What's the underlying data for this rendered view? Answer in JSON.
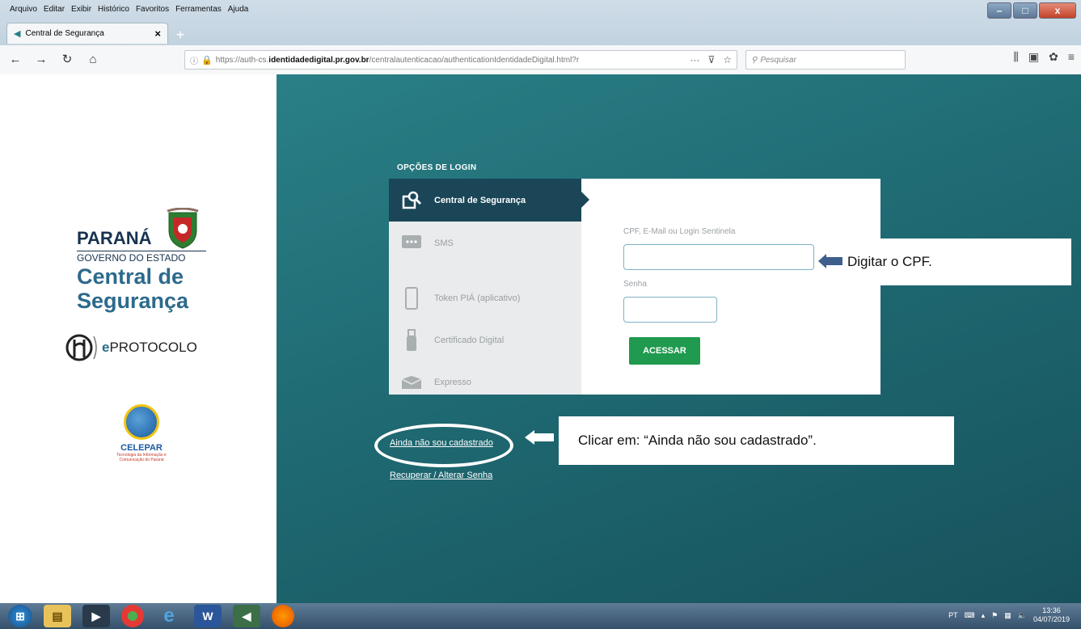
{
  "browser": {
    "menu": [
      "Arquivo",
      "Editar",
      "Exibir",
      "Histórico",
      "Favoritos",
      "Ferramentas",
      "Ajuda"
    ],
    "tab_title": "Central de Segurança",
    "tab_close": "×",
    "new_tab": "+",
    "url_prefix": "https://auth-cs.",
    "url_domain": "identidadedigital.pr.gov.br",
    "url_path": "/centralautenticacao/authenticationIdentidadeDigital.html?r",
    "search_placeholder": "Pesquisar",
    "window_controls": [
      "–",
      "□",
      "x"
    ]
  },
  "brand": {
    "state": "PARANÁ",
    "government": "GOVERNO DO ESTADO",
    "product_line1": "Central de",
    "product_line2": "Segurança",
    "eprotocolo_prefix": "e",
    "eprotocolo_rest": "PROTOCOLO",
    "celepar_name": "CELEPAR",
    "celepar_sub": "Tecnologia da Informação e Comunicação do Paraná"
  },
  "login": {
    "options_title": "OPÇÕES DE LOGIN",
    "options": [
      {
        "label": "Central de Segurança",
        "icon": "search-doc-icon"
      },
      {
        "label": "SMS",
        "icon": "sms-icon"
      },
      {
        "label": "Token PIÁ (aplicativo)",
        "icon": "phone-icon"
      },
      {
        "label": "Certificado Digital",
        "icon": "usb-icon"
      },
      {
        "label": "Expresso",
        "icon": "envelope-icon"
      }
    ],
    "cpf_label": "CPF, E-Mail ou Login Sentinela",
    "senha_label": "Senha",
    "cpf_value": "",
    "senha_value": "",
    "submit_label": "ACESSAR",
    "register_link": "Ainda não sou cadastrado",
    "recover_link": "Recuperar / Alterar Senha"
  },
  "annotations": {
    "callout_cpf": "Digitar o CPF.",
    "callout_register": "Clicar em: “Ainda não sou cadastrado”."
  },
  "taskbar": {
    "language": "PT",
    "time": "13:36",
    "date": "04/07/2019"
  },
  "colors": {
    "teal_bg": "#1f6a73",
    "menu_active": "#1a4657",
    "submit_green": "#1f9a4e"
  }
}
